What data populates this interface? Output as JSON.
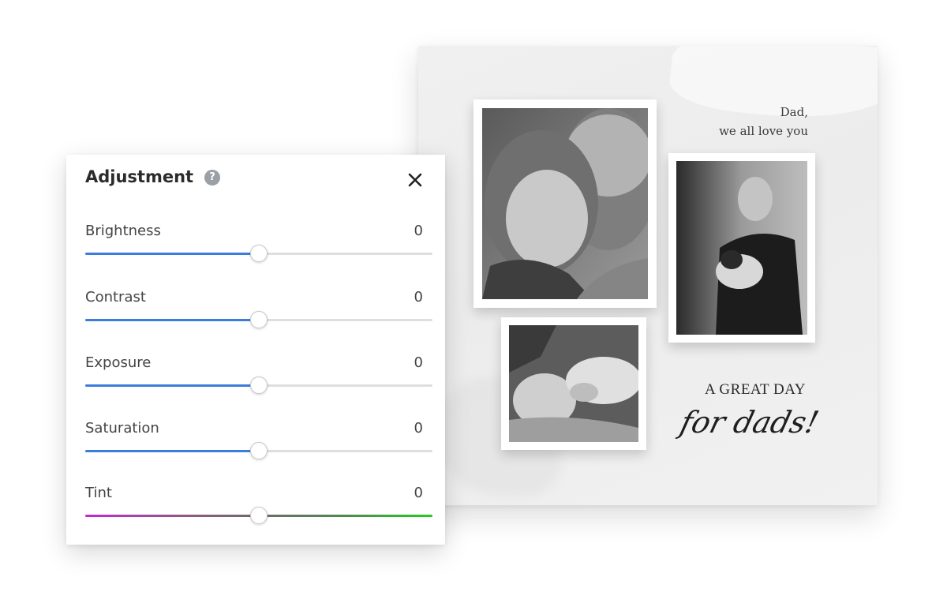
{
  "panel": {
    "title": "Adjustment",
    "help_icon": "help-icon",
    "close_icon": "close-icon",
    "sliders": [
      {
        "label": "Brightness",
        "value": "0",
        "level": 0.5
      },
      {
        "label": "Contrast",
        "value": "0",
        "level": 0.5
      },
      {
        "label": "Exposure",
        "value": "0",
        "level": 0.5
      },
      {
        "label": "Saturation",
        "value": "0",
        "level": 0.5
      },
      {
        "label": "Tint",
        "value": "0",
        "level": 0.5
      }
    ]
  },
  "card": {
    "dad_line1": "Dad,",
    "dad_line2": "we all love you",
    "title": "A GREAT DAY",
    "script": "for dads!"
  },
  "colors": {
    "accent": "#3b7ddd",
    "tint_start": "#c22ad2",
    "tint_end": "#1fcf1f"
  }
}
